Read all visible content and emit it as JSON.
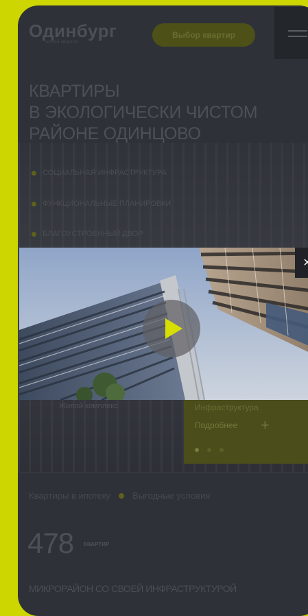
{
  "header": {
    "logo": "Одинбург",
    "logo_sub": "жилой квартал",
    "choose_button": "Выбор квартир"
  },
  "hero": {
    "title_lines": [
      "КВАРТИРЫ",
      "В ЭКОЛОГИЧЕСКИ ЧИСТОМ",
      "РАЙОНЕ ОДИНЦОВО"
    ],
    "features": [
      "Социальная инфраструктура",
      "Функциональные планировки",
      "Благоустроенный двор"
    ],
    "tower_caption": "Жилой комплекс",
    "card_line": "Инфраструктура",
    "card_more": "Подробнее",
    "card_plus": "+"
  },
  "video": {
    "close_label": "×",
    "accent": "#d7df00"
  },
  "stats": {
    "ticker_left": "Квартиры в ипотеку",
    "ticker_right": "Выгодные условия",
    "apartments_count": "478",
    "apartments_unit": "квартир",
    "micro_heading": "МИКРОРАЙОН СО СВОЕЙ ИНФРАСТРУКТУРОЙ"
  },
  "colors": {
    "brand_lime": "#cdd600",
    "overlay": "#2e3138"
  }
}
